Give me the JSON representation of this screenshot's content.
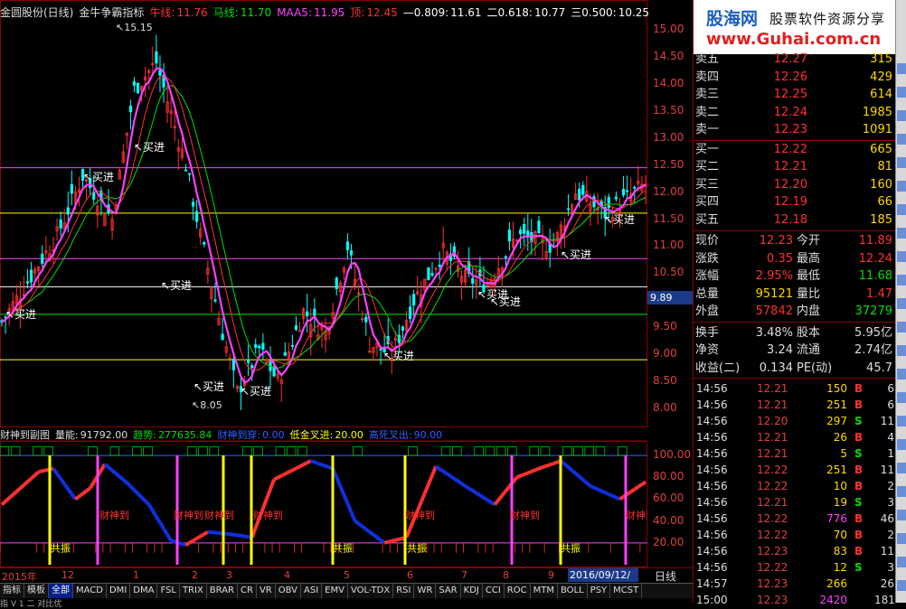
{
  "colors": {
    "up": "#ff3030",
    "down": "#00e000",
    "yellow": "#ffff00",
    "magenta": "#ff40ff",
    "cyan": "#00c0c0",
    "blue": "#1030e0"
  },
  "title": {
    "stock": "金圆股份(日线)",
    "indicator": "金牛争霸指标",
    "niu_label": "牛线:",
    "niu_value": "11.76",
    "ma_label": "马线:",
    "ma_value": "11.70",
    "maa5_label": "MAA5:",
    "maa5_value": "11.95",
    "top_label": "顶:",
    "top_value": "12.45",
    "f1_label": "—0.809:",
    "f1_value": "11.61",
    "f2_label": "二0.618:",
    "f2_value": "10.77",
    "f3_label": "三0.500:",
    "f3_value": "10.25"
  },
  "price_axis": [
    "15.00",
    "14.50",
    "14.00",
    "13.50",
    "13.00",
    "12.50",
    "12.00",
    "11.50",
    "11.00",
    "10.50",
    "10.00",
    "9.50",
    "9.00",
    "8.50",
    "8.00"
  ],
  "current_price_tag": "9.89",
  "annotations": {
    "high": "15.15",
    "low": "8.05",
    "buy": "买进"
  },
  "indicator_title": {
    "name": "财神到副图",
    "vol_label": "量能:",
    "vol_value": "91792.00",
    "trend_label": "趋势:",
    "trend_value": "277635.84",
    "cs_label": "财神到穿:",
    "cs_value": "0.00",
    "dj_label": "低金叉进:",
    "dj_value": "20.00",
    "gs_label": "高死叉出:",
    "gs_value": "90.00"
  },
  "indicator_axis": [
    "100.00",
    "80.00",
    "60.00",
    "40.00",
    "20.00"
  ],
  "indicator_labels": {
    "cs": "财神到",
    "gz": "共振"
  },
  "date_axis": {
    "year": "2015年",
    "marks": [
      "12",
      "1",
      "2",
      "3",
      "4",
      "5",
      "6",
      "7",
      "8",
      "9"
    ],
    "current": "2016/09/12/—",
    "period": "日线"
  },
  "tabs": [
    "指标",
    "模板",
    "全部",
    "MACD",
    "DMI",
    "DMA",
    "FSL",
    "TRIX",
    "BRAR",
    "CR",
    "VR",
    "OBV",
    "ASI",
    "EMV",
    "VOL-TDX",
    "RSI",
    "WR",
    "SAR",
    "KDJ",
    "CCI",
    "ROC",
    "MTM",
    "BOLL",
    "PSY",
    "MCST"
  ],
  "active_tab": "全部",
  "bottom_text": "指 V 1 二 对比优",
  "logo": {
    "brand": "股海网",
    "slogan": "股票软件资源分享",
    "url": "www.Guhai.com.cn"
  },
  "order_book": {
    "sell": [
      {
        "label": "卖五",
        "price": "12.27",
        "vol": "315"
      },
      {
        "label": "卖四",
        "price": "12.26",
        "vol": "429"
      },
      {
        "label": "卖三",
        "price": "12.25",
        "vol": "614"
      },
      {
        "label": "卖二",
        "price": "12.24",
        "vol": "1985"
      },
      {
        "label": "卖一",
        "price": "12.23",
        "vol": "1091"
      }
    ],
    "buy": [
      {
        "label": "买一",
        "price": "12.22",
        "vol": "665"
      },
      {
        "label": "买二",
        "price": "12.21",
        "vol": "81"
      },
      {
        "label": "买三",
        "price": "12.20",
        "vol": "160"
      },
      {
        "label": "买四",
        "price": "12.19",
        "vol": "66"
      },
      {
        "label": "买五",
        "price": "12.18",
        "vol": "185"
      }
    ]
  },
  "quote": [
    {
      "l1": "现价",
      "v1": "12.23",
      "l2": "今开",
      "v2": "11.89"
    },
    {
      "l1": "涨跌",
      "v1": "0.35",
      "l2": "最高",
      "v2": "12.24"
    },
    {
      "l1": "涨幅",
      "v1": "2.95%",
      "l2": "最低",
      "v2": "11.68"
    },
    {
      "l1": "总量",
      "v1": "95121",
      "l2": "量比",
      "v2": "1.47"
    },
    {
      "l1": "外盘",
      "v1": "57842",
      "l2": "内盘",
      "v2": "37279"
    }
  ],
  "fundamentals": [
    {
      "l1": "换手",
      "v1": "3.48%",
      "l2": "股本",
      "v2": "5.95亿"
    },
    {
      "l1": "净资",
      "v1": "3.24",
      "l2": "流通",
      "v2": "2.74亿"
    },
    {
      "l1": "收益(二)",
      "v1": "0.134",
      "l2": "PE(动)",
      "v2": "45.7"
    }
  ],
  "ticks": [
    {
      "t": "14:56",
      "p": "12.21",
      "q": "150",
      "bs": "B",
      "n": "6"
    },
    {
      "t": "14:56",
      "p": "12.21",
      "q": "251",
      "bs": "B",
      "n": "6"
    },
    {
      "t": "14:56",
      "p": "12.20",
      "q": "297",
      "bs": "S",
      "n": "11"
    },
    {
      "t": "14:56",
      "p": "12.21",
      "q": "26",
      "bs": "B",
      "n": "4"
    },
    {
      "t": "14:56",
      "p": "12.21",
      "q": "5",
      "bs": "S",
      "n": "1"
    },
    {
      "t": "14:56",
      "p": "12.22",
      "q": "251",
      "bs": "B",
      "n": "11"
    },
    {
      "t": "14:56",
      "p": "12.22",
      "q": "10",
      "bs": "B",
      "n": "2"
    },
    {
      "t": "14:56",
      "p": "12.21",
      "q": "19",
      "bs": "S",
      "n": "3"
    },
    {
      "t": "14:56",
      "p": "12.22",
      "q": "776",
      "bs": "B",
      "n": "46"
    },
    {
      "t": "14:56",
      "p": "12.22",
      "q": "70",
      "bs": "B",
      "n": "2"
    },
    {
      "t": "14:56",
      "p": "12.23",
      "q": "83",
      "bs": "B",
      "n": "11"
    },
    {
      "t": "14:56",
      "p": "12.22",
      "q": "12",
      "bs": "S",
      "n": "3"
    },
    {
      "t": "14:57",
      "p": "12.23",
      "q": "266",
      "bs": "",
      "n": "26"
    },
    {
      "t": "15:00",
      "p": "12.23",
      "q": "2420",
      "bs": "",
      "n": "181"
    }
  ]
}
